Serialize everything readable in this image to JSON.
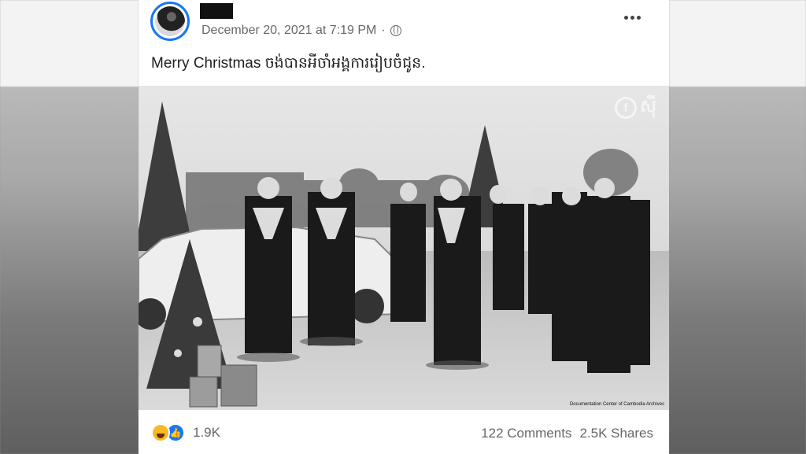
{
  "post": {
    "timestamp": "December 20, 2021 at 7:19 PM",
    "separator": "·",
    "caption": "Merry Christmas ចង់បានអីចាំអង្គការរៀបចំជូន.",
    "more_icon": "more-options-icon",
    "privacy_icon": "globe-icon"
  },
  "photo": {
    "watermark": "ស៊ី",
    "watermark_icon": "facebook-f-icon",
    "credit": "Documentation Center of Cambodia Archives"
  },
  "footer": {
    "reaction_count": "1.9K",
    "comments": "122 Comments",
    "shares": "2.5K Shares",
    "reaction_icons": [
      "haha-icon",
      "like-icon"
    ]
  },
  "colors": {
    "accent": "#1877f2",
    "meta_text": "#65676b"
  }
}
